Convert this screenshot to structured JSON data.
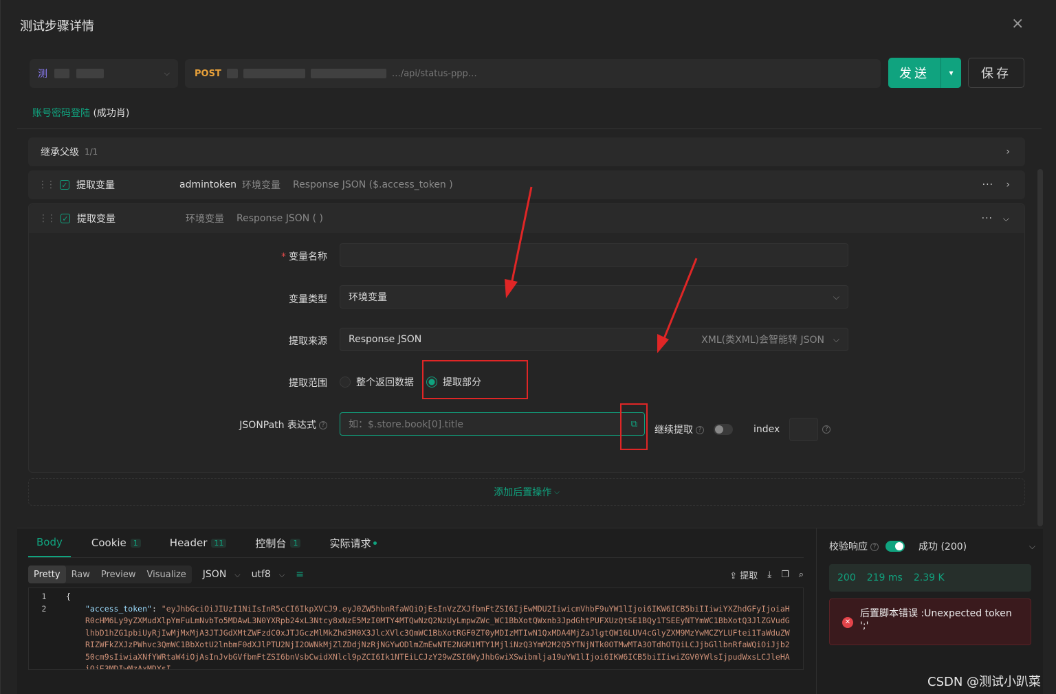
{
  "header": {
    "title": "测试步骤详情",
    "close_icon": "×"
  },
  "request": {
    "env_tag": "测",
    "method": "POST",
    "url_visible": "…/api/status-ppp…",
    "send_label": "发送",
    "save_label": "保存"
  },
  "breadcrumb": {
    "link": "账号密码登陆",
    "status": "(成功肖)"
  },
  "inherit": {
    "label": "继承父级",
    "count": "1/1"
  },
  "extract_rows": [
    {
      "label": "提取变量",
      "var": "admintoken",
      "type": "环境变量",
      "source": "Response JSON ($.access_token )"
    },
    {
      "label": "提取变量",
      "var": "",
      "type": "环境变量",
      "source": "Response JSON ( )"
    }
  ],
  "form": {
    "var_name_label": "变量名称",
    "var_type_label": "变量类型",
    "var_type_value": "环境变量",
    "source_label": "提取来源",
    "source_value": "Response JSON",
    "source_hint": "XML(类XML)会智能转 JSON",
    "scope_label": "提取范围",
    "scope_all": "整个返回数据",
    "scope_part": "提取部分",
    "jsonpath_label": "JSONPath 表达式",
    "jsonpath_placeholder": "如：$.store.book[0].title",
    "continue_label": "继续提取",
    "index_label": "index"
  },
  "add_post": "添加后置操作",
  "response": {
    "tabs": [
      {
        "label": "Body"
      },
      {
        "label": "Cookie",
        "badge": "1"
      },
      {
        "label": "Header",
        "badge": "11"
      },
      {
        "label": "控制台",
        "badge": "1"
      },
      {
        "label": "实际请求"
      }
    ],
    "views": [
      "Pretty",
      "Raw",
      "Preview",
      "Visualize"
    ],
    "format": "JSON",
    "encoding": "utf8",
    "extract_label": "提取",
    "line_numbers": [
      "1",
      "2"
    ],
    "line1": "{",
    "key": "\"access_token\"",
    "value": "\"eyJhbGciOiJIUzI1NiIsInR5cCI6IkpXVCJ9.eyJ0ZW5hbnRfaWQiOjEsInVzZXJfbmFtZSI6IjEwMDU2IiwicmVhbF9uYW1lIjoi6IKW6ICB5biIIiwiYXZhdGFyIjoiaHR0cHM6Ly9yZXMudXlpYmFuLmNvbTo5MDAwL3N0YXRpb24xL3Ntcy8xNzE5MzI0MTY4MTQwNzQ2NzUyLmpwZWc_WC1BbXotQWxnb3JpdGhtPUFXUzQtSE1BQy1TSEEyNTYmWC1BbXotQ3JlZGVudGlhbD1hZG1pbiUyRjIwMjMxMjA3JTJGdXMtZWFzdC0xJTJGczMlMkZhd3M0X3JlcXVlc3QmWC1BbXotRGF0ZT0yMDIzMTIwN1QxMDA4MjZaJlgtQW16LUV4cGlyZXM9MzYwMCZYLUFtei1TaWduZWRIZWFkZXJzPWhvc3QmWC1BbXotU2lnbmF0dXJlPTU2NjI2OWNkMjZlZDdjNzRjNGYwODlmZmEwNTE2NGM1MTY1MjliNzQ3YmM2M2Q5YTNjNTk0OTMwMTA3OTdhOTQiLCJjbGllbnRfaWQiOiJjb250cm9sIiwiaXNfYWRtaW4iOjAsInJvbGVfbmFtZSI6bnVsbCwidXNlcl9pZCI6Ik1NTEiLCJzY29wZSI6WyJhbGwiXSwibmlja19uYW1lIjoi6IKW6ICB5biIIiwiZGV0YWlsIjpudWxsLCJleHAiOjE3MDIwMzAxMDYsI"
  },
  "side": {
    "validate_label": "校验响应",
    "status_text": "成功 (200)",
    "code": "200",
    "time": "219 ms",
    "size": "2.39 K",
    "error_text": "后置脚本错误 :Unexpected token ';'"
  },
  "watermark": "CSDN @测试小趴菜",
  "colors": {
    "accent": "#10a37f",
    "error": "#e34b4b",
    "annotation": "#e02626"
  }
}
